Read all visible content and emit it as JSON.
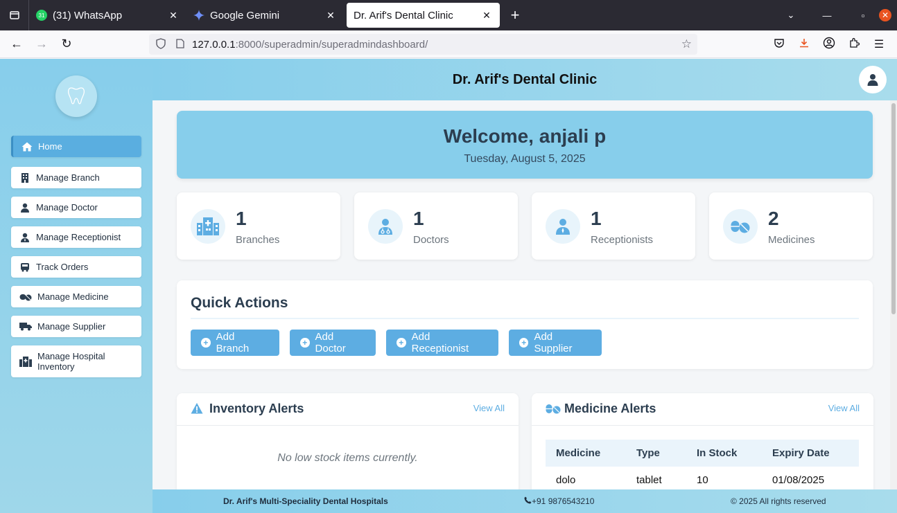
{
  "browser": {
    "tabs": [
      {
        "title": "(31) WhatsApp",
        "badge": "31"
      },
      {
        "title": "Google Gemini"
      },
      {
        "title": "Dr. Arif's Dental Clinic"
      }
    ],
    "url_host": "127.0.0.1",
    "url_path": ":8000/superadmin/superadmindashboard/"
  },
  "sidebar": {
    "items": [
      {
        "label": "Home",
        "icon": "home-icon"
      },
      {
        "label": "Manage Branch",
        "icon": "building-icon"
      },
      {
        "label": "Manage Doctor",
        "icon": "doctor-icon"
      },
      {
        "label": "Manage Receptionist",
        "icon": "user-tie-icon"
      },
      {
        "label": "Track Orders",
        "icon": "bus-icon"
      },
      {
        "label": "Manage Medicine",
        "icon": "pills-icon"
      },
      {
        "label": "Manage Supplier",
        "icon": "truck-icon"
      },
      {
        "label": "Manage Hospital Inventory",
        "icon": "hospital-icon"
      }
    ]
  },
  "header": {
    "title": "Dr. Arif's Dental Clinic"
  },
  "welcome": {
    "greeting": "Welcome, anjali p",
    "date": "Tuesday, August 5, 2025"
  },
  "stats": [
    {
      "value": "1",
      "label": "Branches"
    },
    {
      "value": "1",
      "label": "Doctors"
    },
    {
      "value": "1",
      "label": "Receptionists"
    },
    {
      "value": "2",
      "label": "Medicines"
    }
  ],
  "quick_actions": {
    "title": "Quick Actions",
    "buttons": [
      "Add Branch",
      "Add Doctor",
      "Add Receptionist",
      "Add Supplier"
    ]
  },
  "inventory_alerts": {
    "title": "Inventory Alerts",
    "view_all": "View All",
    "empty": "No low stock items currently."
  },
  "medicine_alerts": {
    "title": "Medicine Alerts",
    "view_all": "View All",
    "columns": [
      "Medicine",
      "Type",
      "In Stock",
      "Expiry Date"
    ],
    "rows": [
      [
        "dolo",
        "tablet",
        "10",
        "01/08/2025"
      ]
    ]
  },
  "footer": {
    "name": "Dr. Arif's Multi-Speciality Dental Hospitals",
    "phone": "+91 9876543210",
    "copyright": "© 2025 All rights reserved"
  },
  "colors": {
    "accent": "#5dade2",
    "sidebar": "#87ceeb",
    "dark_text": "#2c3e50"
  }
}
